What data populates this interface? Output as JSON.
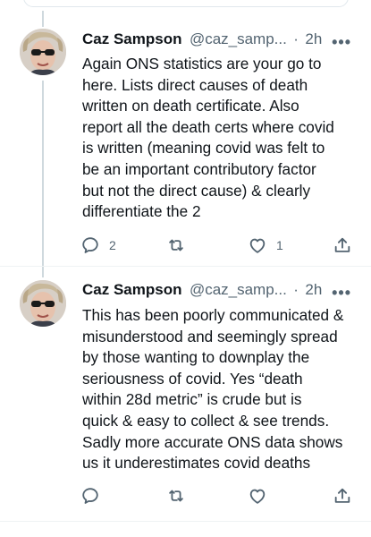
{
  "tweets": [
    {
      "author_name": "Caz Sampson",
      "handle": "@caz_samp...",
      "separator": "·",
      "time": "2h",
      "text": "Again ONS statistics are your go to\nhere. Lists direct causes of death\nwritten on death certificate. Also\nreport all the death certs where covid\nis written (meaning covid was felt to\nbe an important contributory factor\nbut not the direct cause) & clearly\ndifferentiate the 2",
      "reply_count": "2",
      "retweet_count": "",
      "like_count": "1"
    },
    {
      "author_name": "Caz Sampson",
      "handle": "@caz_samp...",
      "separator": "·",
      "time": "2h",
      "text": "This has been poorly communicated &\nmisunderstood and seemingly spread\nby those wanting to downplay the\nseriousness of covid. Yes “death\nwithin 28d metric” is crude but is\nquick & easy to collect & see trends.\nSadly more accurate ONS data shows\nus it underestimates covid deaths",
      "reply_count": "",
      "retweet_count": "",
      "like_count": ""
    }
  ],
  "icons": {
    "reply": "reply-icon",
    "retweet": "retweet-icon",
    "like": "heart-icon",
    "share": "share-icon",
    "more": "more-icon"
  },
  "more_glyph": "•••",
  "colors": {
    "text": "#0f1419",
    "secondary": "#536471",
    "thread_line": "#cfd9de",
    "divider": "#eff3f4"
  }
}
